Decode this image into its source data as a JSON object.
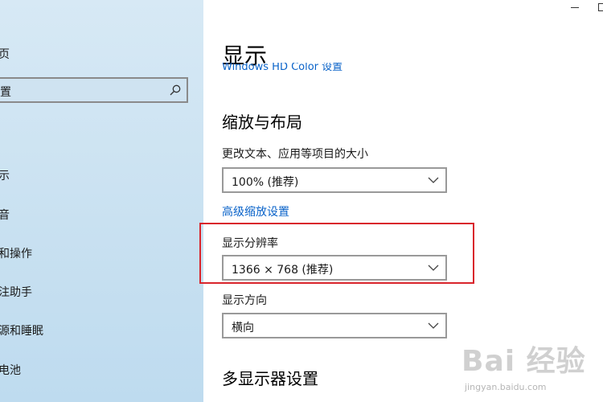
{
  "sidebar": {
    "home_label": "页",
    "search_text": "置",
    "items": [
      {
        "label": "示",
        "icon": "display-icon"
      },
      {
        "label": "音",
        "icon": "sound-icon"
      },
      {
        "label": "和操作",
        "icon": "notifications-icon"
      },
      {
        "label": "注助手",
        "icon": "focus-assist-icon"
      },
      {
        "label": "源和睡眠",
        "icon": "power-sleep-icon"
      },
      {
        "label": "电池",
        "icon": "battery-icon"
      }
    ]
  },
  "main": {
    "title": "显示",
    "header_link": "Windows HD Color 设置",
    "scale_section_title": "缩放与布局",
    "text_size_label": "更改文本、应用等项目的大小",
    "text_size_value": "100% (推荐)",
    "advanced_scaling_link": "高级缩放设置",
    "resolution_label": "显示分辨率",
    "resolution_value": "1366 × 768 (推荐)",
    "orientation_label": "显示方向",
    "orientation_value": "横向",
    "multi_display_title": "多显示器设置"
  },
  "watermark": {
    "main": "Bai 经验",
    "sub": "jingyan.baidu.com"
  },
  "colors": {
    "accent": "#0a63c9",
    "highlight_border": "#d9252c",
    "sidebar_bg": "#cfe3f1"
  }
}
